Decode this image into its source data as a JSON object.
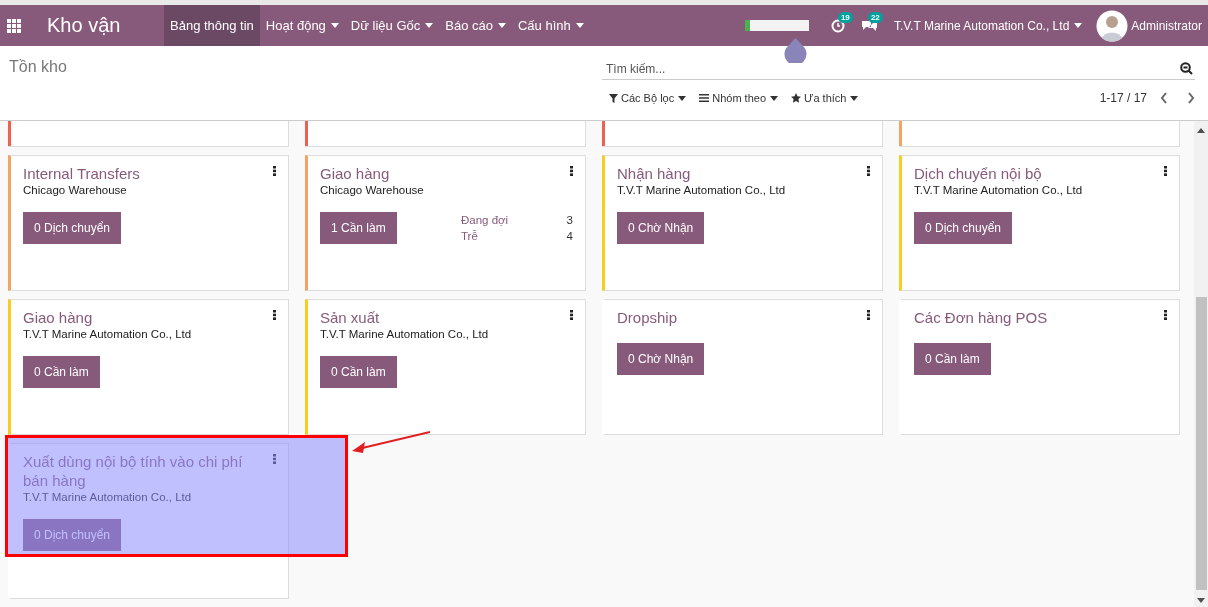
{
  "navbar": {
    "app_title": "Kho vận",
    "menus": [
      {
        "label": "Bảng thông tin",
        "selected": true,
        "dropdown": false
      },
      {
        "label": "Hoạt động",
        "selected": false,
        "dropdown": true
      },
      {
        "label": "Dữ liệu Gốc",
        "selected": false,
        "dropdown": true
      },
      {
        "label": "Báo cáo",
        "selected": false,
        "dropdown": true
      },
      {
        "label": "Cấu hình",
        "selected": false,
        "dropdown": true
      }
    ],
    "loading": {
      "level": 0.08
    },
    "activity_count": "19",
    "message_count": "22",
    "company": "T.V.T Marine Automation Co., Ltd",
    "user": "Administrator"
  },
  "control_panel": {
    "breadcrumb": "Tồn kho",
    "search": {
      "placeholder": "Tìm kiếm..."
    },
    "filters": [
      {
        "label": "Các Bộ lọc",
        "kind": "filter"
      },
      {
        "label": "Nhóm theo",
        "kind": "group"
      },
      {
        "label": "Ưa thích",
        "kind": "favorite"
      }
    ],
    "pager": "1-17 / 17"
  },
  "kanban": {
    "partial_cards": [
      {
        "color": "#f06050"
      },
      {
        "color": "#f06050"
      },
      {
        "color": "#f06050"
      },
      {
        "color": "#f4a460"
      }
    ],
    "cards": [
      {
        "title": "Internal Transfers",
        "subtitle": "Chicago Warehouse",
        "button": "0 Dịch chuyển",
        "color": "#f4a460",
        "highlighted": false
      },
      {
        "title": "Giao hàng",
        "subtitle": "Chicago Warehouse",
        "button": "1 Cần làm",
        "color": "#f4a460",
        "highlighted": false,
        "stats": [
          {
            "label": "Đang đợi",
            "value": "3"
          },
          {
            "label": "Trễ",
            "value": "4"
          }
        ]
      },
      {
        "title": "Nhận hàng",
        "subtitle": "T.V.T Marine Automation Co., Ltd",
        "button": "0 Chờ Nhận",
        "color": "#f7cd1f",
        "highlighted": false
      },
      {
        "title": "Dịch chuyển nội bộ",
        "subtitle": "T.V.T Marine Automation Co., Ltd",
        "button": "0 Dịch chuyển",
        "color": "#f7cd1f",
        "highlighted": false
      },
      {
        "title": "Giao hàng",
        "subtitle": "T.V.T Marine Automation Co., Ltd",
        "button": "0 Cần làm",
        "color": "#f7cd1f",
        "highlighted": false
      },
      {
        "title": "Sản xuất",
        "subtitle": "T.V.T Marine Automation Co., Ltd",
        "button": "0 Cần làm",
        "color": "#f7cd1f",
        "highlighted": false
      },
      {
        "title": "Dropship",
        "button": "0 Chờ Nhận",
        "highlighted": false
      },
      {
        "title": "Các Đơn hàng POS",
        "button": "0 Cần làm",
        "highlighted": false
      },
      {
        "title": "Xuất dùng nội bộ tính vào chi phí bán hàng",
        "subtitle": "T.V.T Marine Automation Co., Ltd",
        "button": "0 Dịch chuyển",
        "highlighted": true
      }
    ]
  }
}
